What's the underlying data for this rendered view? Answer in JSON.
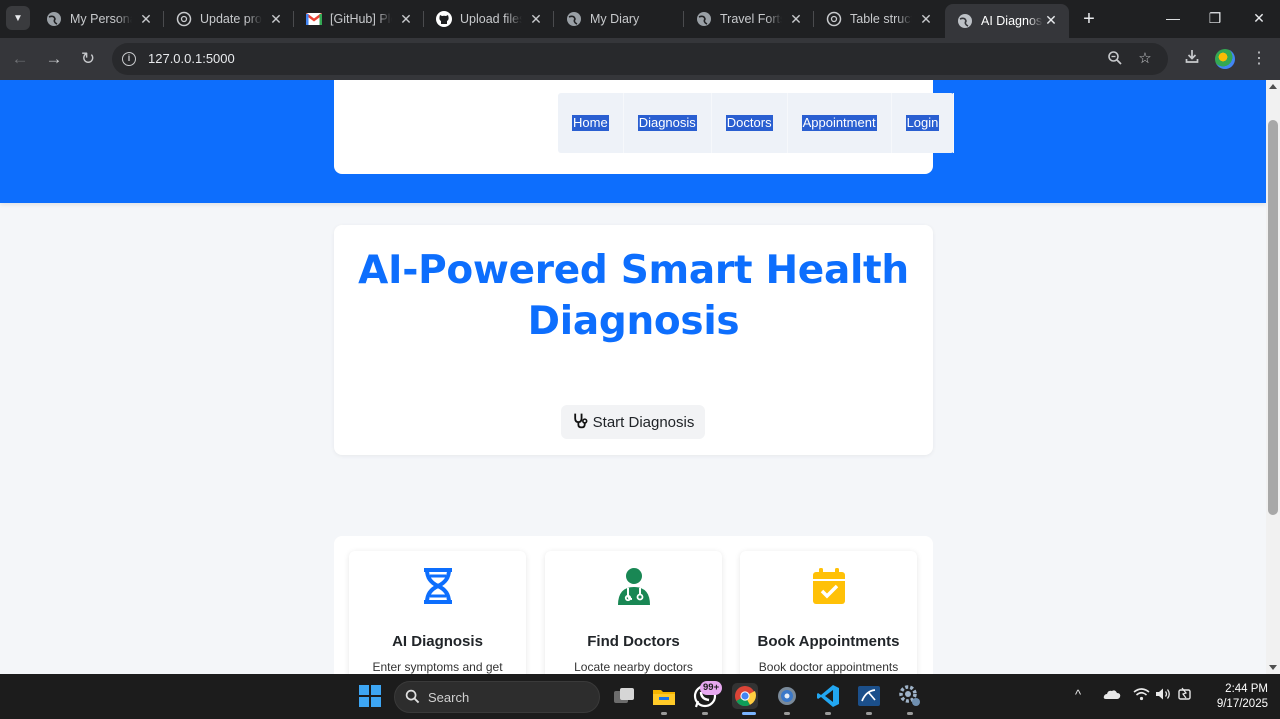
{
  "browser": {
    "tabs": [
      {
        "title": "My Personal",
        "favicon": "globe-icon",
        "active": false
      },
      {
        "title": "Update proje",
        "favicon": "chatgpt-icon",
        "active": false
      },
      {
        "title": "[GitHub] Plea",
        "favicon": "gmail-icon",
        "active": false
      },
      {
        "title": "Upload files",
        "favicon": "github-icon",
        "active": false
      },
      {
        "title": "My Diary",
        "favicon": "globe-icon",
        "active": false
      },
      {
        "title": "Travel Forts",
        "favicon": "globe-icon",
        "active": false
      },
      {
        "title": "Table structu",
        "favicon": "chatgpt-icon",
        "active": false
      },
      {
        "title": "AI Diagnosis",
        "favicon": "globe-icon",
        "active": true
      }
    ],
    "url": "127.0.0.1:5000"
  },
  "nav": {
    "links": [
      "Home",
      "Diagnosis",
      "Doctors",
      "Appointment",
      "Login"
    ]
  },
  "hero": {
    "title": "AI-Powered Smart Health Diagnosis",
    "button_label": "Start Diagnosis"
  },
  "features": [
    {
      "title": "AI Diagnosis",
      "text": "Enter symptoms and get AI-based disease",
      "icon": "dna-icon",
      "color": "#0d6efd"
    },
    {
      "title": "Find Doctors",
      "text": "Locate nearby doctors and hospitals instantly with",
      "icon": "doctor-icon",
      "color": "#198754"
    },
    {
      "title": "Book Appointments",
      "text": "Book doctor appointments seamlessly and get instant",
      "icon": "calendar-check-icon",
      "color": "#ffc107"
    }
  ],
  "taskbar": {
    "search_placeholder": "Search",
    "whatsapp_badge": "99+",
    "time": "2:44 PM",
    "date": "9/17/2025"
  },
  "colors": {
    "primary": "#0d6efd",
    "page_bg": "#f4f6f9"
  }
}
